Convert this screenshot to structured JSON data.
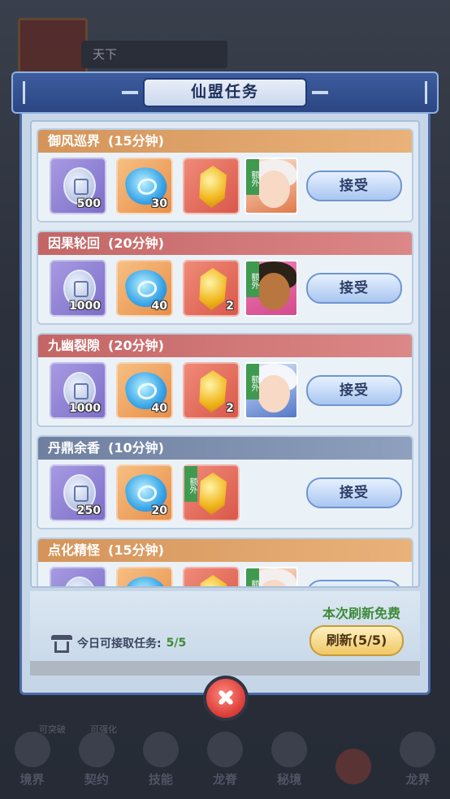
{
  "background": {
    "top_label": "天下",
    "bottom_nav": [
      "境界",
      "契约",
      "技能",
      "龙脊",
      "秘境",
      "",
      "龙界"
    ],
    "bottom_tags": [
      "可突破",
      "可强化"
    ]
  },
  "panel": {
    "title": "仙盟任务"
  },
  "accept_label": "接受",
  "extra_label": "额外",
  "tasks": [
    {
      "name": "御风巡界",
      "duration": "(15分钟)",
      "silver": "500",
      "gems": "30",
      "stone": ""
    },
    {
      "name": "因果轮回",
      "duration": "(20分钟)",
      "silver": "1000",
      "gems": "40",
      "stone": "2"
    },
    {
      "name": "九幽裂隙",
      "duration": "(20分钟)",
      "silver": "1000",
      "gems": "40",
      "stone": "2"
    },
    {
      "name": "丹鼎余香",
      "duration": "(10分钟)",
      "silver": "250",
      "gems": "20",
      "stone": ""
    },
    {
      "name": "点化精怪",
      "duration": "(15分钟)",
      "silver": "",
      "gems": "",
      "stone": ""
    }
  ],
  "footer": {
    "free_text": "本次刷新免费",
    "refresh_label": "刷新(5/5)",
    "daily_label": "今日可接取任务:",
    "daily_value": "5/5"
  },
  "colors": {
    "accept": "#a9c6f0",
    "refresh": "#f0c866",
    "close": "#d93a34",
    "free_text": "#3e8a3a"
  },
  "icons": [
    "silver-coin-icon",
    "blue-gem-icon",
    "gold-stone-icon",
    "pagoda-icon",
    "close-icon"
  ]
}
